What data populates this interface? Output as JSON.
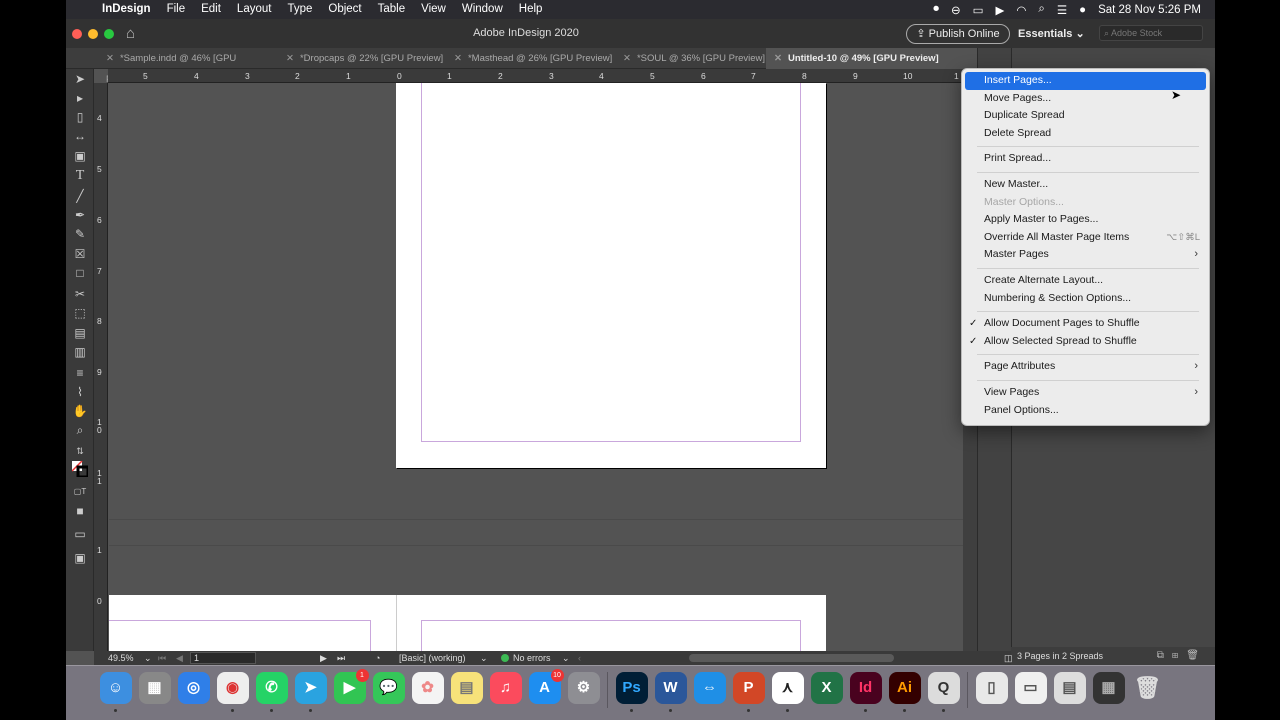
{
  "menubar": {
    "app_name": "InDesign",
    "items": [
      "File",
      "Edit",
      "Layout",
      "Type",
      "Object",
      "Table",
      "View",
      "Window",
      "Help"
    ],
    "clock": "Sat 28 Nov  5:26 PM"
  },
  "titlebar": {
    "title": "Adobe InDesign 2020",
    "publish_label": "Publish Online",
    "workspace_label": "Essentials",
    "stock_placeholder": "Adobe Stock"
  },
  "tabs": [
    {
      "label": "*Sample.indd @ 46% [GPU Preview]"
    },
    {
      "label": "*Dropcaps @ 22% [GPU Preview]"
    },
    {
      "label": "*Masthead @ 26% [GPU Preview]"
    },
    {
      "label": "*SOUL @ 36% [GPU Preview]"
    },
    {
      "label": "Untitled-10 @ 49% [GPU Preview]"
    }
  ],
  "ruler": {
    "h_ticks": [
      "5",
      "4",
      "3",
      "2",
      "1",
      "0",
      "1",
      "2",
      "3",
      "4",
      "5",
      "6",
      "7",
      "8",
      "9",
      "10",
      "1"
    ],
    "v_ticks": [
      "4",
      "5",
      "6",
      "7",
      "8",
      "9",
      "1\n0",
      "1\n1",
      "1",
      "0"
    ]
  },
  "statusbar": {
    "zoom": "49.5%",
    "page": "1",
    "master": "[Basic] (working)",
    "preflight": "No errors"
  },
  "panel": {
    "footer_text": "3 Pages in 2 Spreads"
  },
  "context_menu": {
    "items": [
      {
        "label": "Insert Pages..."
      },
      {
        "label": "Move Pages..."
      },
      {
        "label": "Duplicate Spread"
      },
      {
        "label": "Delete Spread"
      },
      {
        "label": "Print Spread..."
      },
      {
        "label": "New Master..."
      },
      {
        "label": "Master Options..."
      },
      {
        "label": "Apply Master to Pages..."
      },
      {
        "label": "Override All Master Page Items",
        "shortcut": "⌥⇧⌘L"
      },
      {
        "label": "Master Pages"
      },
      {
        "label": "Create Alternate Layout..."
      },
      {
        "label": "Numbering & Section Options..."
      },
      {
        "label": "Allow Document Pages to Shuffle"
      },
      {
        "label": "Allow Selected Spread to Shuffle"
      },
      {
        "label": "Page Attributes"
      },
      {
        "label": "View Pages"
      },
      {
        "label": "Panel Options..."
      }
    ]
  },
  "dock": {
    "ps_label": "Ps",
    "id_label": "Id",
    "ai_label": "Ai",
    "facetime_badge": "1",
    "appstore_badge": "10"
  }
}
